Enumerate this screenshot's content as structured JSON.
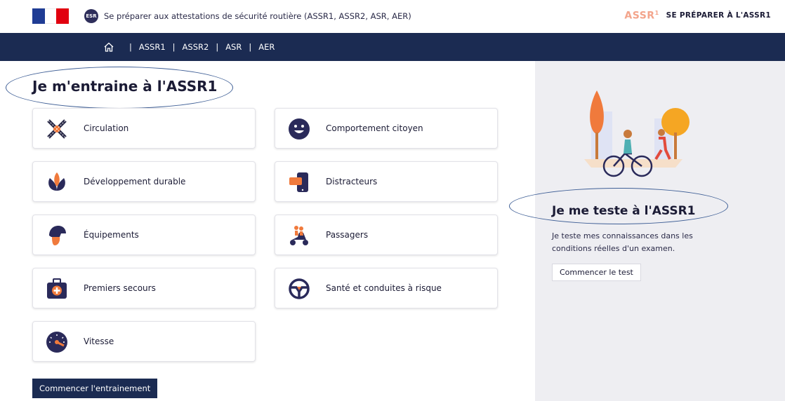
{
  "header": {
    "esr_badge": "ESR",
    "site_title": "Se préparer aux attestations de sécurité routière (ASSR1, ASSR2, ASR, AER)",
    "brand_logo": "ASSR",
    "brand_logo_sup": "1",
    "brand_link": "SE PRÉPARER À L'ASSR1"
  },
  "nav": {
    "home_icon": "home-icon",
    "sep": "|",
    "items": [
      "ASSR1",
      "ASSR2",
      "ASR",
      "AER"
    ]
  },
  "main": {
    "title": "Je m'entraine à l'ASSR1",
    "cards": [
      {
        "label": "Circulation",
        "icon": "crossroads-icon"
      },
      {
        "label": "Comportement citoyen",
        "icon": "smiley-icon"
      },
      {
        "label": "Développement durable",
        "icon": "leaves-icon"
      },
      {
        "label": "Distracteurs",
        "icon": "phone-icon"
      },
      {
        "label": "Équipements",
        "icon": "helmet-icon"
      },
      {
        "label": "Passagers",
        "icon": "scooter-icon"
      },
      {
        "label": "Premiers secours",
        "icon": "first-aid-kit-icon"
      },
      {
        "label": "Santé et conduites à risque",
        "icon": "steering-wheel-icon"
      },
      {
        "label": "Vitesse",
        "icon": "speedometer-icon"
      }
    ],
    "start_button": "Commencer l'entrainement"
  },
  "side": {
    "title": "Je me teste à l'ASSR1",
    "description": "Je teste mes connaissances dans les conditions réelles d'un examen.",
    "button": "Commencer le test",
    "illustration": "cyclist-runner-illustration"
  },
  "colors": {
    "navy": "#1b2b52",
    "text": "#1b1b35",
    "panel": "#eeeef2",
    "accent_orange": "#f07a3c",
    "annotation_oval": "#3f5f96"
  }
}
